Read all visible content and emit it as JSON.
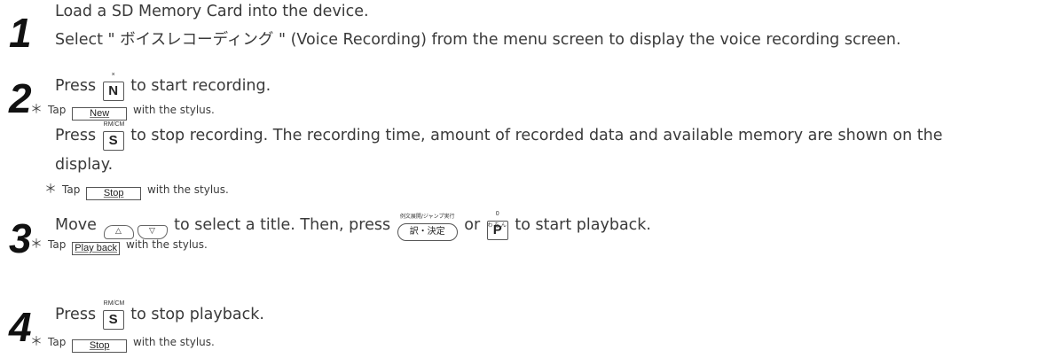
{
  "steps": [
    {
      "number": "1",
      "lines": [
        "Load a SD Memory Card into the device.",
        "Select \" ボイスレコーディング \" (Voice Recording) from the menu screen to display the voice recording screen."
      ]
    },
    {
      "number": "2",
      "press_n": {
        "before": "Press",
        "key": "N",
        "key_sup": "×",
        "after": "to start recording."
      },
      "tap_new": {
        "before": "Tap",
        "button": "New",
        "after": "with the stylus."
      },
      "press_s": {
        "before": "Press",
        "key": "S",
        "key_sup": "RM/CM",
        "after": "to stop recording. The recording time, amount of recorded data and available memory are shown on the",
        "cont": "display."
      },
      "tap_stop": {
        "before": "Tap",
        "button": "Stop",
        "after": "with the stylus."
      }
    },
    {
      "number": "3",
      "move": {
        "before": "Move",
        "up_arrow": "△",
        "down_arrow": "▽",
        "mid": "to select a title. Then, press",
        "enter_key": "訳・決定",
        "enter_sup": "例文展開/ジャンプ実行",
        "or": "or",
        "p_key": "P",
        "p_sup": "0",
        "p_side": "わ を ん",
        "after": "to start playback."
      },
      "tap_play": {
        "before": "Tap",
        "button": "Play back",
        "after": "with the stylus."
      }
    },
    {
      "number": "4",
      "press_s": {
        "before": "Press",
        "key": "S",
        "key_sup": "RM/CM",
        "after": "to stop playback."
      },
      "tap_stop": {
        "before": "Tap",
        "button": "Stop",
        "after": "with the stylus."
      }
    }
  ],
  "note_marker": "＊"
}
